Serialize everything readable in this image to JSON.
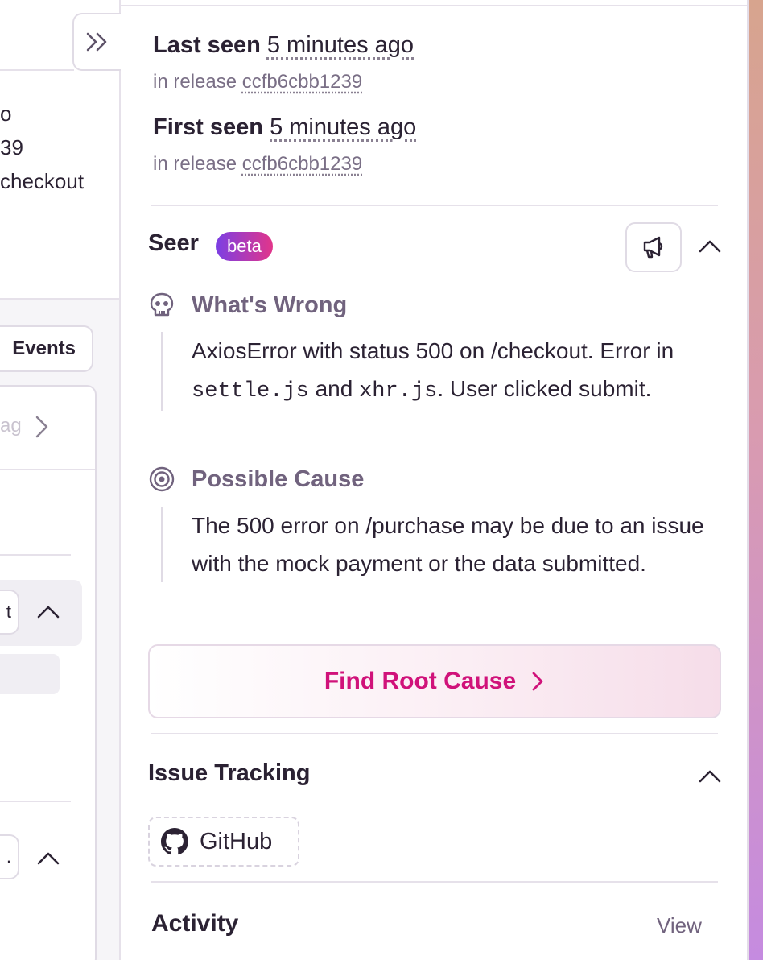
{
  "left_panel": {
    "text_lines": [
      "o",
      "39",
      "checkout"
    ],
    "events_button_label": "Events",
    "tag_input_text": "ag",
    "mini_button_1": "t",
    "mini_button_2": "."
  },
  "sidebar": {
    "last_seen": {
      "label": "Last seen",
      "value": "5 minutes ago",
      "release_prefix": "in release",
      "release": "ccfb6cbb1239"
    },
    "first_seen": {
      "label": "First seen",
      "value": "5 minutes ago",
      "release_prefix": "in release",
      "release": "ccfb6cbb1239"
    },
    "seer": {
      "title": "Seer",
      "badge": "beta",
      "whats_wrong": {
        "title": "What's Wrong",
        "text_1": "AxiosError with status 500 on /checkout. Error in",
        "code_1": "settle.js",
        "text_2": "and",
        "code_2": "xhr.js",
        "text_3": ". User clicked submit."
      },
      "possible_cause": {
        "title": "Possible Cause",
        "text": "The 500 error on /purchase may be due to an issue with the mock payment or the data submitted."
      },
      "find_root_cause_label": "Find Root Cause"
    },
    "issue_tracking": {
      "title": "Issue Tracking",
      "github_label": "GitHub"
    },
    "activity": {
      "title": "Activity",
      "view_label": "View"
    }
  },
  "colors": {
    "accent_pink": "#d0127a",
    "badge_start": "#7b3fe4",
    "badge_end": "#e2358a",
    "muted_purple": "#71637e",
    "text_dark": "#2b2233"
  },
  "icons": [
    "chevron-double-right-icon",
    "megaphone-icon",
    "chevron-up-icon",
    "skull-icon",
    "target-icon",
    "chevron-right-icon",
    "github-icon"
  ]
}
